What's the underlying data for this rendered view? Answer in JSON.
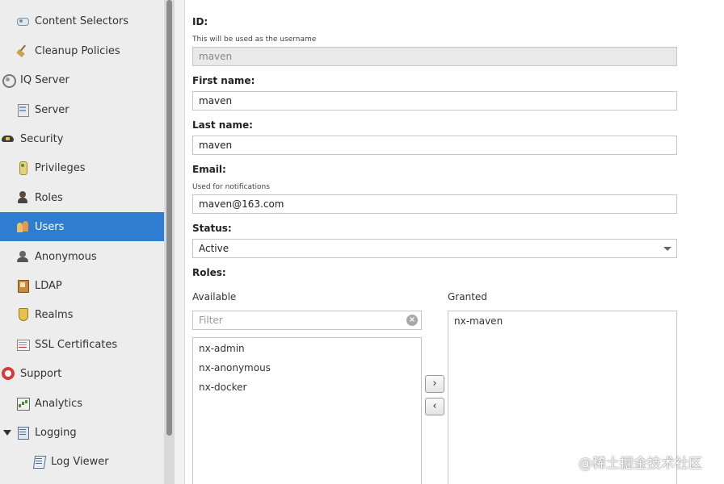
{
  "sidebar": {
    "items": [
      {
        "label": "Content Selectors",
        "icon": "selectors-icon",
        "level": 1
      },
      {
        "label": "Cleanup Policies",
        "icon": "broom-icon",
        "level": 1
      },
      {
        "label": "IQ Server",
        "icon": "iq-server-icon",
        "level": 0
      },
      {
        "label": "Server",
        "icon": "server-icon",
        "level": 1
      },
      {
        "label": "Security",
        "icon": "security-icon",
        "level": 0
      },
      {
        "label": "Privileges",
        "icon": "privileges-icon",
        "level": 1
      },
      {
        "label": "Roles",
        "icon": "roles-icon",
        "level": 1
      },
      {
        "label": "Users",
        "icon": "users-icon",
        "level": 1,
        "selected": true
      },
      {
        "label": "Anonymous",
        "icon": "anonymous-icon",
        "level": 1
      },
      {
        "label": "LDAP",
        "icon": "ldap-icon",
        "level": 1
      },
      {
        "label": "Realms",
        "icon": "realms-icon",
        "level": 1
      },
      {
        "label": "SSL Certificates",
        "icon": "ssl-certificates-icon",
        "level": 1
      },
      {
        "label": "Support",
        "icon": "support-icon",
        "level": 0
      },
      {
        "label": "Analytics",
        "icon": "analytics-icon",
        "level": 1
      },
      {
        "label": "Logging",
        "icon": "logging-icon",
        "level": 0,
        "expanded": true
      },
      {
        "label": "Log Viewer",
        "icon": "log-viewer-icon",
        "level": 2
      }
    ],
    "selected_color": "#2e7dd1"
  },
  "form": {
    "id": {
      "label": "ID:",
      "help": "This will be used as the username",
      "value": "maven"
    },
    "first_name": {
      "label": "First name:",
      "value": "maven"
    },
    "last_name": {
      "label": "Last name:",
      "value": "maven"
    },
    "email": {
      "label": "Email:",
      "help": "Used for notifications",
      "value": "maven@163.com"
    },
    "status": {
      "label": "Status:",
      "value": "Active"
    },
    "roles": {
      "label": "Roles:",
      "available_title": "Available",
      "granted_title": "Granted",
      "filter_placeholder": "Filter",
      "available": [
        "nx-admin",
        "nx-anonymous",
        "nx-docker"
      ],
      "granted": [
        "nx-maven"
      ],
      "add_glyph": "›",
      "remove_glyph": "‹"
    }
  },
  "watermark": "@稀土掘金技术社区"
}
